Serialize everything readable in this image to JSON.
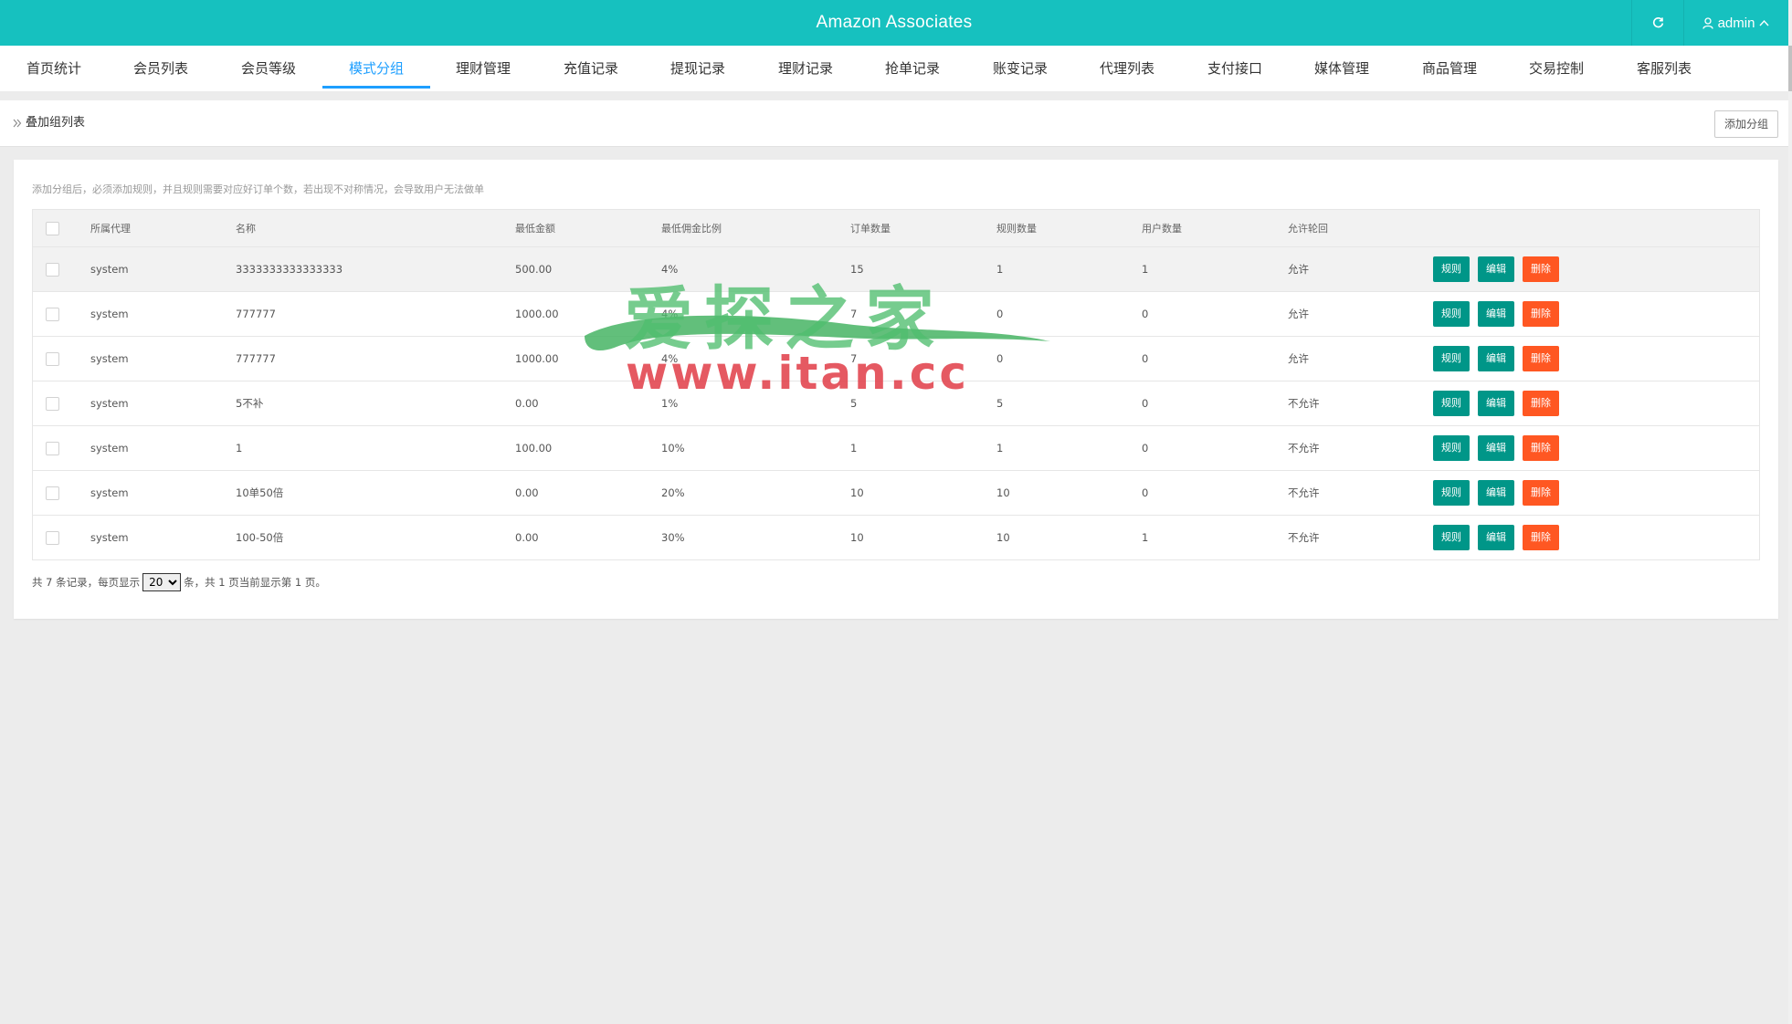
{
  "app": {
    "title": "Amazon Associates",
    "user": "admin",
    "accent": "#16c1bf"
  },
  "nav": {
    "tabs": [
      {
        "label": "首页统计"
      },
      {
        "label": "会员列表"
      },
      {
        "label": "会员等级"
      },
      {
        "label": "模式分组"
      },
      {
        "label": "理财管理"
      },
      {
        "label": "充值记录"
      },
      {
        "label": "提现记录"
      },
      {
        "label": "理财记录"
      },
      {
        "label": "抢单记录"
      },
      {
        "label": "账变记录"
      },
      {
        "label": "代理列表"
      },
      {
        "label": "支付接口"
      },
      {
        "label": "媒体管理"
      },
      {
        "label": "商品管理"
      },
      {
        "label": "交易控制"
      },
      {
        "label": "客服列表"
      }
    ],
    "active": "模式分组"
  },
  "breadcrumb": {
    "label": "叠加组列表",
    "add_button": "添加分组"
  },
  "content": {
    "tip": "添加分组后，必须添加规则，并且规则需要对应好订单个数，若出现不对称情况，会导致用户无法做单"
  },
  "table": {
    "headers": [
      "所属代理",
      "名称",
      "最低金额",
      "最低佣金比例",
      "订单数量",
      "规则数量",
      "用户数量",
      "允许轮回"
    ],
    "rows": [
      {
        "agent": "system",
        "name": "3333333333333333",
        "min_amount": "500.00",
        "min_rate": "4%",
        "orders": "15",
        "rules": "1",
        "users": "1",
        "cycle": "允许"
      },
      {
        "agent": "system",
        "name": "777777",
        "min_amount": "1000.00",
        "min_rate": "4%",
        "orders": "7",
        "rules": "0",
        "users": "0",
        "cycle": "允许"
      },
      {
        "agent": "system",
        "name": "777777",
        "min_amount": "1000.00",
        "min_rate": "4%",
        "orders": "7",
        "rules": "0",
        "users": "0",
        "cycle": "允许"
      },
      {
        "agent": "system",
        "name": "5不补",
        "min_amount": "0.00",
        "min_rate": "1%",
        "orders": "5",
        "rules": "5",
        "users": "0",
        "cycle": "不允许"
      },
      {
        "agent": "system",
        "name": "1",
        "min_amount": "100.00",
        "min_rate": "10%",
        "orders": "1",
        "rules": "1",
        "users": "0",
        "cycle": "不允许"
      },
      {
        "agent": "system",
        "name": "10单50倍",
        "min_amount": "0.00",
        "min_rate": "20%",
        "orders": "10",
        "rules": "10",
        "users": "0",
        "cycle": "不允许"
      },
      {
        "agent": "system",
        "name": "100-50倍",
        "min_amount": "0.00",
        "min_rate": "30%",
        "orders": "10",
        "rules": "10",
        "users": "1",
        "cycle": "不允许"
      }
    ],
    "actions": {
      "rules": "规则",
      "edit": "编辑",
      "delete": "删除"
    }
  },
  "pager": {
    "prefix": "共 7 条记录，每页显示",
    "per_page": "20",
    "suffix": "条，共 1 页当前显示第 1 页。"
  },
  "watermark": {
    "cn": "爱探之家",
    "url": "www.itan.cc"
  }
}
